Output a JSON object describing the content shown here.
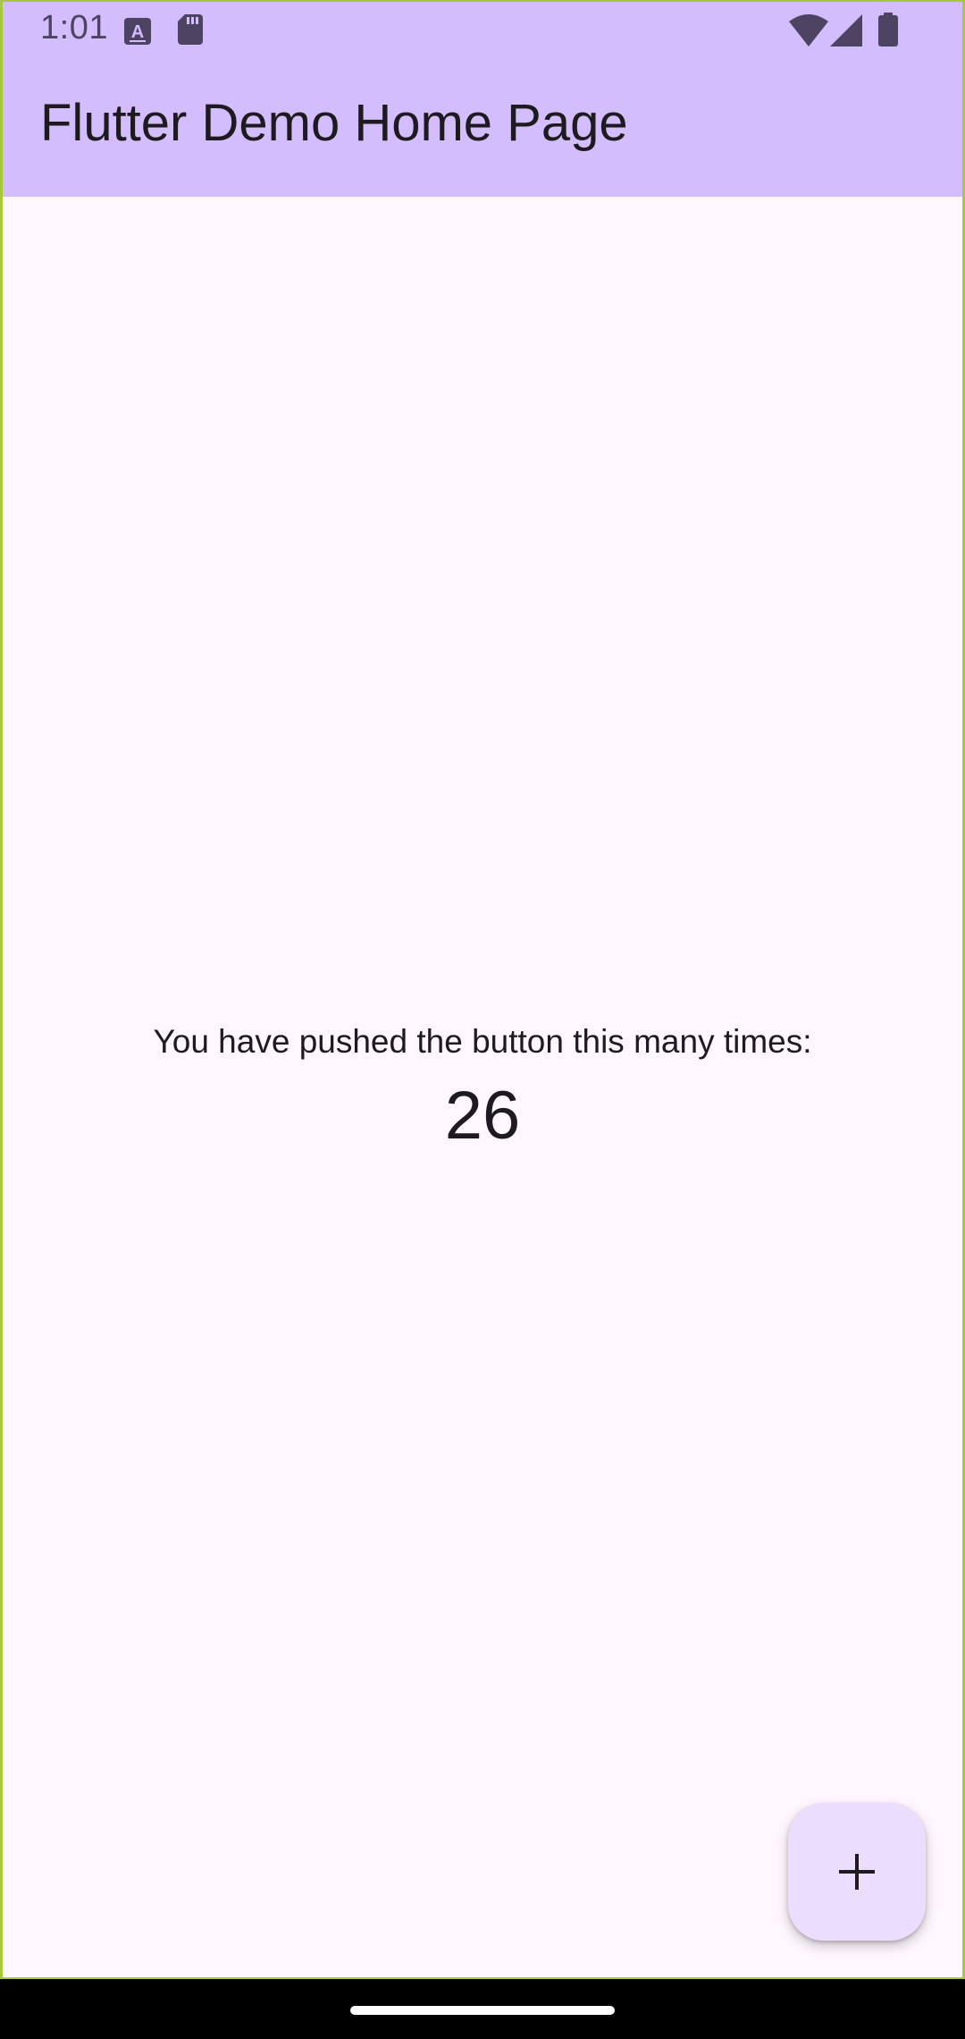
{
  "status_bar": {
    "time": "1:01",
    "icons": [
      "font-a-icon",
      "sd-card-icon",
      "wifi-icon",
      "cell-signal-icon",
      "battery-icon"
    ]
  },
  "app_bar": {
    "title": "Flutter Demo Home Page"
  },
  "body": {
    "counter_label": "You have pushed the button this many times:",
    "counter_value": "26"
  },
  "fab": {
    "icon": "plus-icon"
  },
  "colors": {
    "app_bar_bg": "#d3bdfc",
    "page_bg": "#fff7fe",
    "fab_bg": "#eaddfd",
    "text": "#1d1b20",
    "status_icon": "#4d4463"
  }
}
